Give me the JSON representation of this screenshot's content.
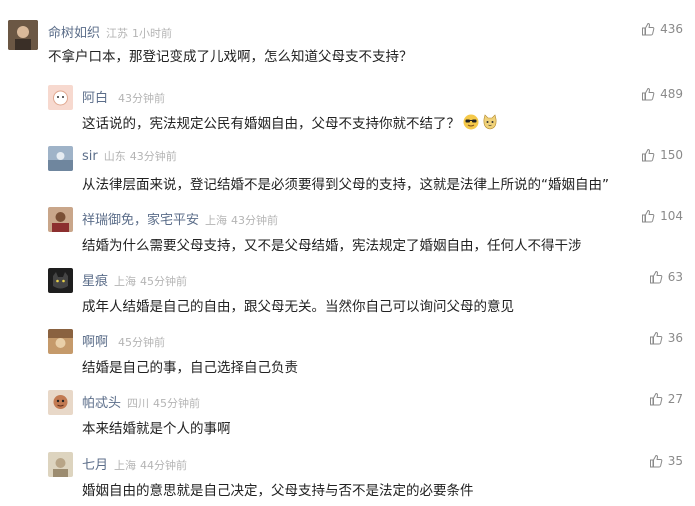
{
  "comments": [
    {
      "user": "命树如织",
      "loc": "江苏",
      "time": "1小时前",
      "likes": "436",
      "text": "不拿户口本，那登记变成了儿戏啊，怎么知道父母支不支持？",
      "avatar_color": "#5a4a3a"
    },
    {
      "user": "阿白",
      "loc": "",
      "time": "43分钟前",
      "likes": "489",
      "text": "这话说的，宪法规定公民有婚姻自由，父母不支持你就不结了？",
      "emoji": [
        "sunglasses-emoji-icon",
        "cat-emoji-icon"
      ],
      "avatar_color": "#f2c9b8"
    },
    {
      "user": "sir",
      "loc": "山东",
      "time": "43分钟前",
      "likes": "150",
      "text": "从法律层面来说，登记结婚不是必须要得到父母的支持，这就是法律上所说的“婚姻自由”",
      "avatar_color": "#8aa0b8"
    },
    {
      "user": "祥瑞御免，家宅平安",
      "loc": "上海",
      "time": "43分钟前",
      "likes": "104",
      "text": "结婚为什么需要父母支持，又不是父母结婚，宪法规定了婚姻自由，任何人不得干涉",
      "avatar_color": "#b78a6e"
    },
    {
      "user": "星痕",
      "loc": "上海",
      "time": "45分钟前",
      "likes": "63",
      "text": "成年人结婚是自己的自由，跟父母无关。当然你自己可以询问父母的意见",
      "avatar_color": "#2e2e2e"
    },
    {
      "user": "啊啊",
      "loc": "",
      "time": "45分钟前",
      "likes": "36",
      "text": "结婚是自己的事，自己选择自己负责",
      "avatar_color": "#a67c52"
    },
    {
      "user": "帕忒头",
      "loc": "四川",
      "time": "45分钟前",
      "likes": "27",
      "text": "本来结婚就是个人的事啊",
      "avatar_color": "#c98b6b"
    },
    {
      "user": "七月",
      "loc": "上海",
      "time": "44分钟前",
      "likes": "35",
      "text": "婚姻自由的意思就是自己决定，父母支持与否不是法定的必要条件",
      "avatar_color": "#c9c0a8"
    }
  ]
}
